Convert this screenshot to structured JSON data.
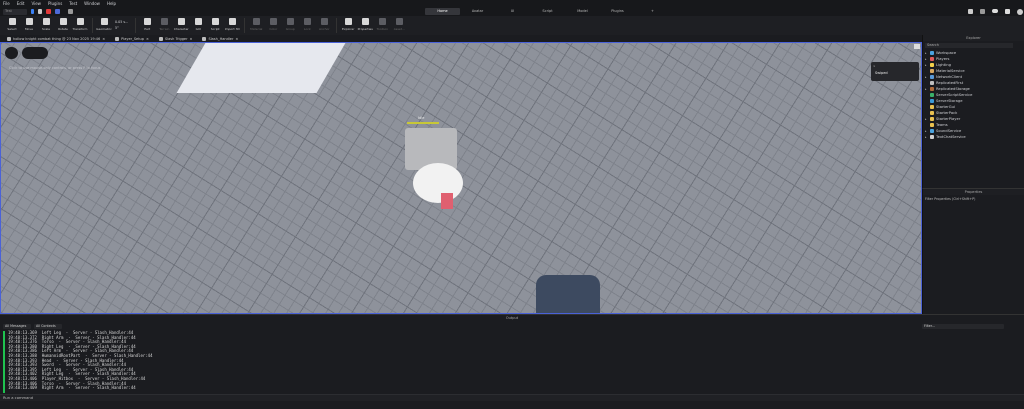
{
  "menu": [
    "File",
    "Edit",
    "View",
    "Plugins",
    "Test",
    "Window",
    "Help"
  ],
  "toolbar": {
    "test_mode": "Test",
    "tabs": [
      "Home",
      "Avatar",
      "UI",
      "Script",
      "Model",
      "Plugins",
      "+"
    ],
    "active_tab": "Home",
    "tools": [
      {
        "label": "Select",
        "on": true
      },
      {
        "label": "Move",
        "on": true
      },
      {
        "label": "Scale",
        "on": true
      },
      {
        "label": "Rotate",
        "on": true
      },
      {
        "label": "Transform",
        "on": true
      },
      {
        "label": "Geometric",
        "on": true
      },
      {
        "label": "Part",
        "on": true
      },
      {
        "label": "Terrain",
        "on": false
      },
      {
        "label": "Character",
        "on": true
      },
      {
        "label": "GUI",
        "on": true
      },
      {
        "label": "Script",
        "on": true
      },
      {
        "label": "Import 3D",
        "on": true
      },
      {
        "label": "Material",
        "on": false
      },
      {
        "label": "Color",
        "on": false
      },
      {
        "label": "Group",
        "on": false
      },
      {
        "label": "Lock",
        "on": false
      },
      {
        "label": "Anchor",
        "on": false
      },
      {
        "label": "Explorer",
        "on": true
      },
      {
        "label": "Properties",
        "on": true
      },
      {
        "label": "Toolbox",
        "on": false
      },
      {
        "label": "Asset...",
        "on": false
      }
    ],
    "snap_move": "0.05 s...",
    "snap_rotate": "5°"
  },
  "file_tabs": [
    "hollow knight combat thing @ 23 Nov 2025 19:46",
    "Player_Setup",
    "Slash Trigger",
    "Slash_Handler"
  ],
  "viewport": {
    "hint": "Click to use mouse-only controls, or press F to focus",
    "character_name": "Idle",
    "tooltip": "Swiped"
  },
  "explorer": {
    "title": "Explorer",
    "search_placeholder": "Search",
    "items": [
      {
        "label": "Workspace",
        "color": "#4aa3df",
        "exp": true
      },
      {
        "label": "Players",
        "color": "#e05a5a",
        "exp": true
      },
      {
        "label": "Lighting",
        "color": "#f2d04a",
        "exp": true
      },
      {
        "label": "MaterialService",
        "color": "#d8a860",
        "exp": false
      },
      {
        "label": "NetworkClient",
        "color": "#5a9ad8",
        "exp": true
      },
      {
        "label": "ReplicatedFirst",
        "color": "#c0c0c0",
        "exp": false
      },
      {
        "label": "ReplicatedStorage",
        "color": "#b06a3a",
        "exp": true
      },
      {
        "label": "ServerScriptService",
        "color": "#3ab06a",
        "exp": false
      },
      {
        "label": "ServerStorage",
        "color": "#3a9ad8",
        "exp": false
      },
      {
        "label": "StarterGui",
        "color": "#e8c050",
        "exp": false
      },
      {
        "label": "StarterPack",
        "color": "#e8c050",
        "exp": false
      },
      {
        "label": "StarterPlayer",
        "color": "#e8c050",
        "exp": true
      },
      {
        "label": "Teams",
        "color": "#e8c050",
        "exp": false
      },
      {
        "label": "SoundService",
        "color": "#4aa3df",
        "exp": true
      },
      {
        "label": "TextChatService",
        "color": "#d0d0d0",
        "exp": true
      }
    ]
  },
  "properties": {
    "title": "Properties",
    "filter_placeholder": "Filter Properties (Ctrl+Shift+P)"
  },
  "output": {
    "title": "Output",
    "messages_filter": "All Messages",
    "contexts_filter": "All Contexts",
    "search_placeholder": "Filter...",
    "lines": [
      "19:48:13.369  Left Leg  -  Server - Slash_Handler:44",
      "19:48:13.372  Right Arm  -  Server - Slash_Handler:44",
      "19:48:13.376  Torso  -  Server - Slash_Handler:44",
      "19:48:13.380  Right Leg  -  Server - Slash_Handler:44",
      "19:48:13.386  Left Arm  -  Server - Slash_Handler:44",
      "19:48:13.388  HumanoidRootPart  -  Server - Slash_Handler:44",
      "19:48:13.393  Head  -  Server - Slash_Handler:44",
      "19:48:13.393  Sword  -  Server - Slash_Handler:44",
      "19:48:13.395  Left Leg  -  Server - Slash_Handler:44",
      "19:48:13.402  Right Leg  -  Server - Slash_Handler:44",
      "19:48:13.406  Player_Hitbox  -  Server - Slash_Handler:44",
      "19:48:13.406  Torso  -  Server - Slash_Handler:44",
      "19:48:13.409  Right Arm  -  Server - Slash_Handler:44"
    ],
    "command_placeholder": "Run a command"
  }
}
